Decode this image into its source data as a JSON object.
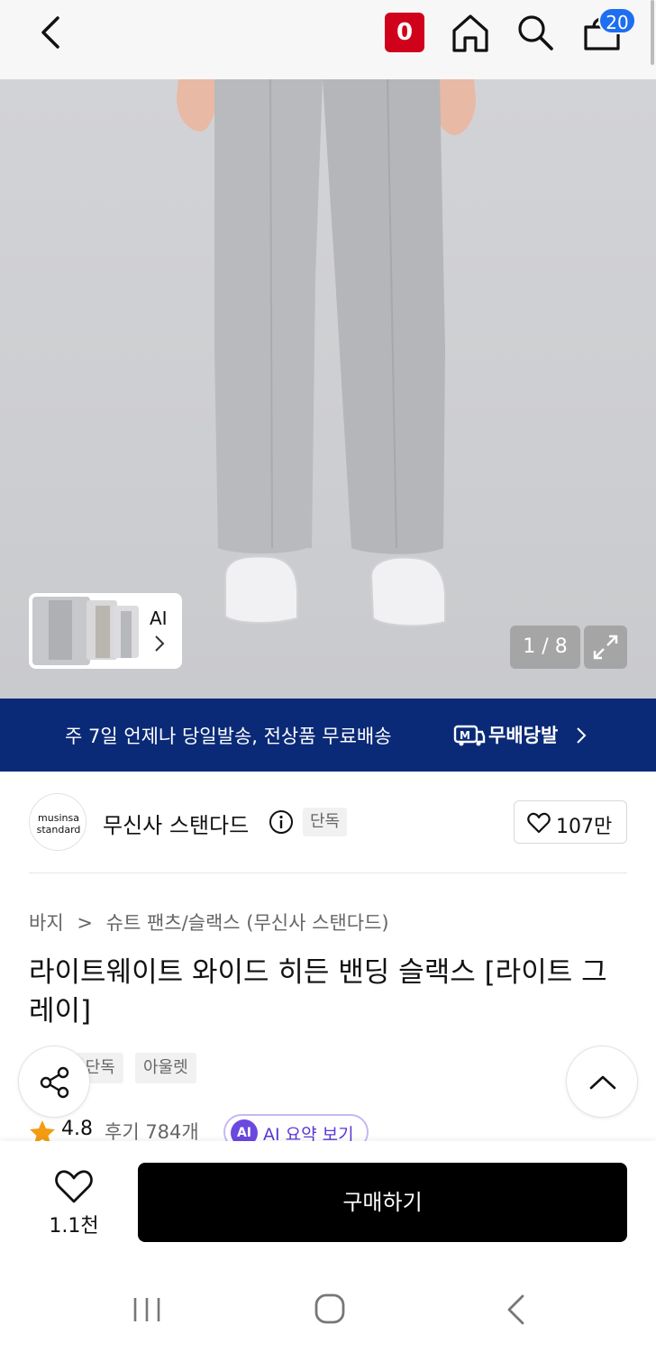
{
  "topbar": {
    "zero_badge": "0",
    "cart_count": "20",
    "icons": [
      "back-chevron-icon",
      "home-icon",
      "search-icon",
      "shopping-bag-icon"
    ]
  },
  "gallery": {
    "thumb_label": "AI",
    "page_indicator": "1 / 8",
    "current_page": 1,
    "total_pages": 8
  },
  "promo": {
    "text": "주 7일 언제나 당일발송, 전상품 무료배송",
    "brand": "무배당발"
  },
  "brand": {
    "logo_line1": "musinsa",
    "logo_line2": "standard",
    "name": "무신사 스탠다드",
    "exclusive_tag": "단독",
    "like_count": "107만"
  },
  "breadcrumb": {
    "category": "바지",
    "subcategory": "슈트 팬츠/슬랙스 (무신사 스탠다드)"
  },
  "product": {
    "title": "라이트웨이트 와이드 히든 밴딩 슬랙스 [라이트 그레이]",
    "tag_a": "무신사단독",
    "tag_b": "아울렛"
  },
  "rating": {
    "score": "4.8",
    "reviews": "후기 784개",
    "ai_badge": "AI",
    "ai_summary": "AI 요약 보기"
  },
  "purchase": {
    "wish_count": "1.1천",
    "buy_label": "구매하기"
  },
  "colors": {
    "promo_bg": "#0a2a78",
    "badge_red": "#d0021b",
    "cart_blue": "#1d6ef0",
    "ai_purple": "#6b48e0",
    "star_orange": "#f39c12"
  }
}
